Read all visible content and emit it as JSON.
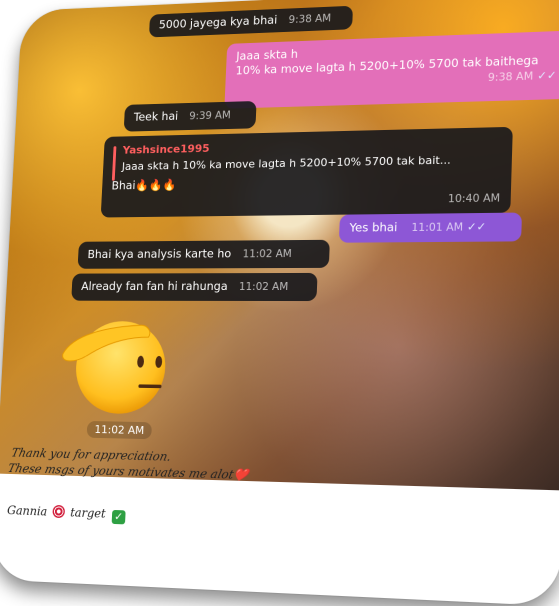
{
  "messages": [
    {
      "text": "5000 jayega kya bhai",
      "time": "9:38 AM"
    },
    {
      "line1": "Jaaa skta h",
      "line2": "10% ka move lagta h 5200+10% 5700 tak baithega",
      "time": "9:38 AM",
      "status": "read"
    },
    {
      "text": "Teek hai",
      "time": "9:39 AM"
    },
    {
      "reply_user": "Yashsince1995",
      "reply_text": "Jaaa skta h 10% ka move lagta h 5200+10% 5700 tak bait...",
      "text": "Bhai🔥🔥🔥",
      "time": "10:40 AM"
    },
    {
      "text": "Yes bhai",
      "time": "11:01 AM",
      "status": "read"
    },
    {
      "text": "Bhai kya analysis karte ho",
      "time": "11:02 AM"
    },
    {
      "text": "Already fan fan hi rahunga",
      "time": "11:02 AM"
    },
    {
      "sticker": "saluting-face",
      "time": "11:02 AM"
    }
  ],
  "caption": {
    "line1": "Thank you for appreciation.",
    "line2": "These msgs of yours motivates me alot❤️",
    "signature": "Gannia",
    "tag": "target",
    "tag_icon": "check-mark-icon"
  },
  "colors": {
    "dark_bubble": "#19191c",
    "outgoing_pink": "#e36fb9",
    "outgoing_purple": "#8d57d6",
    "reply_accent": "#ff5f5f"
  }
}
